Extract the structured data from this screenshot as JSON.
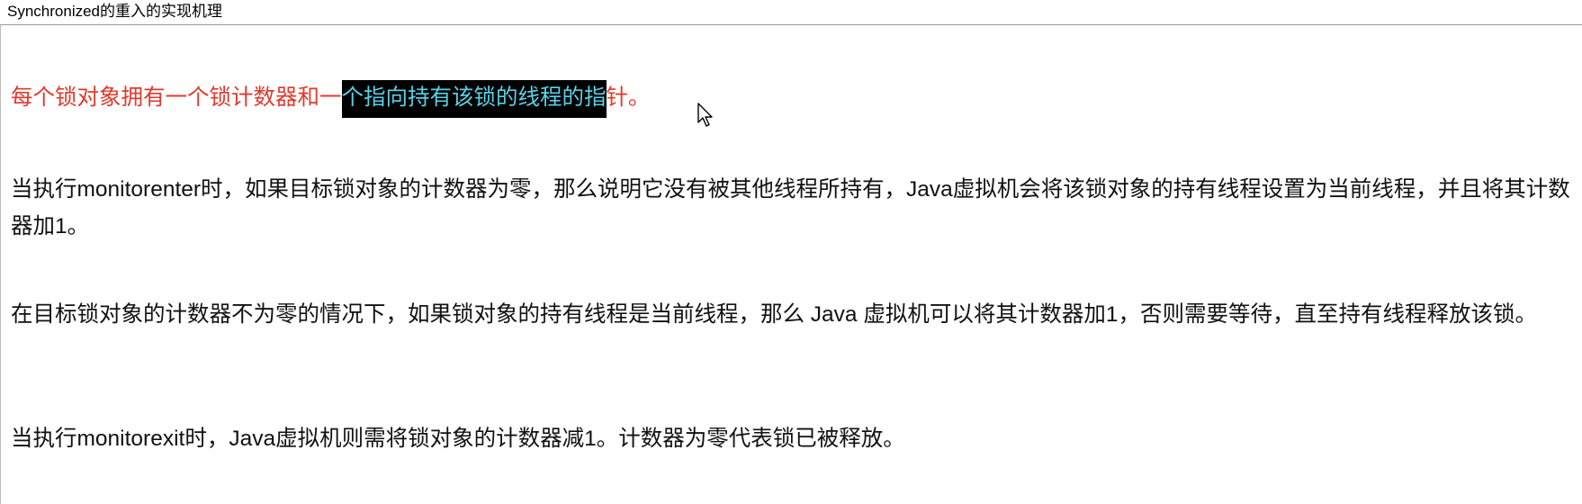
{
  "window": {
    "title": "Synchronized的重入的实现机理"
  },
  "paragraphs": [
    {
      "before": "每个锁对象拥有一个锁计数器和一",
      "highlighted": "个指向持有该锁的线程的指",
      "after": "针。"
    },
    {
      "text": "当执行monitorenter时，如果目标锁对象的计数器为零，那么说明它没有被其他线程所持有，Java虚拟机会将该锁对象的持有线程设置为当前线程，并且将其计数器加1。"
    },
    {
      "text": "在目标锁对象的计数器不为零的情况下，如果锁对象的持有线程是当前线程，那么 Java 虚拟机可以将其计数器加1，否则需要等待，直至持有线程释放该锁。"
    },
    {
      "text": "当执行monitorexit时，Java虚拟机则需将锁对象的计数器减1。计数器为零代表锁已被释放。"
    }
  ],
  "colors": {
    "first_paragraph_text": "#e03a2c",
    "highlight_background": "#000000",
    "highlight_text": "#5ad0e6",
    "body_text": "#111111"
  },
  "icons": {
    "cursor": "mouse-pointer-arrow"
  }
}
